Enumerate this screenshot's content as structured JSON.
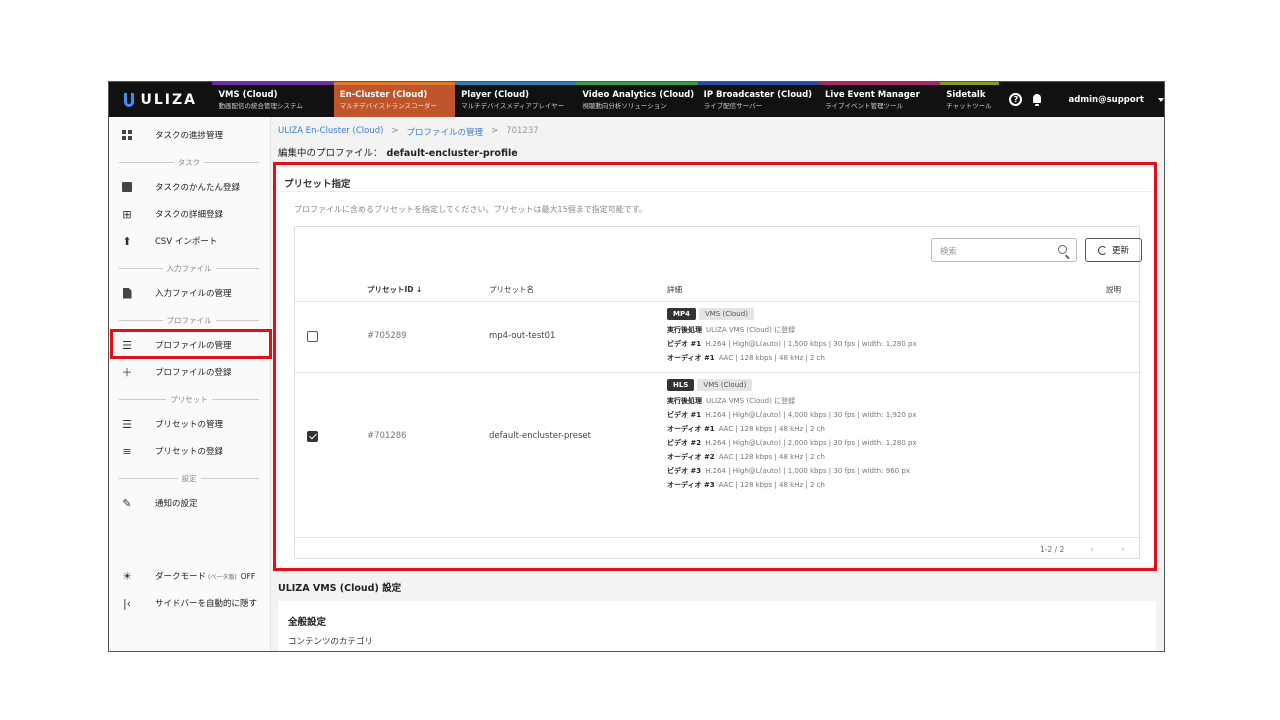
{
  "brand": {
    "logo": "ULIZA"
  },
  "nav": [
    {
      "title": "VMS (Cloud)",
      "sub": "動画配信の統合管理システム",
      "color": "#6b2fa0"
    },
    {
      "title": "En-Cluster (Cloud)",
      "sub": "マルチデバイストランスコーダー",
      "color": "#e07a2a",
      "active": true
    },
    {
      "title": "Player (Cloud)",
      "sub": "マルチデバイスメディアプレイヤー",
      "color": "#2f7fa8"
    },
    {
      "title": "Video Analytics (Cloud)",
      "sub": "視聴動向分析ソリューション",
      "color": "#3a9a4a"
    },
    {
      "title": "IP Broadcaster (Cloud)",
      "sub": "ライブ配信サーバー",
      "color": "#2a4fa0"
    },
    {
      "title": "Live Event Manager",
      "sub": "ライブイベント管理ツール",
      "color": "#a02a6b"
    },
    {
      "title": "Sidetalk",
      "sub": "チャットツール",
      "color": "#8a9a2a"
    }
  ],
  "topright": {
    "help_icon": "?",
    "user": "admin@support"
  },
  "sidebar": {
    "task_progress": "タスクの進捗管理",
    "div_task": "タスク",
    "task_easy": "タスクのかんたん登録",
    "task_detail": "タスクの詳細登録",
    "csv_import": "CSV インポート",
    "div_input": "入力ファイル",
    "input_manage": "入力ファイルの管理",
    "div_profile": "プロファイル",
    "profile_manage": "プロファイルの管理",
    "profile_register": "プロファイルの登録",
    "div_preset": "プリセット",
    "preset_manage": "プリセットの管理",
    "preset_register": "プリセットの登録",
    "div_settings": "設定",
    "notify_settings": "通知の設定",
    "dark_mode": "ダークモード",
    "beta": "(ベータ版)",
    "dark_state": "OFF",
    "auto_hide": "サイドバーを自動的に隠す"
  },
  "breadcrumb": {
    "root": "ULIZA En-Cluster (Cloud)",
    "sep": ">",
    "mid": "プロファイルの管理",
    "current": "701237"
  },
  "editing": {
    "label": "編集中のプロファイル：",
    "name": "default-encluster-profile"
  },
  "preset": {
    "title": "プリセット指定",
    "desc": "プロファイルに含めるプリセットを指定してください。プリセットは最大15個まで指定可能です。",
    "search_placeholder": "検索",
    "refresh": "更新",
    "headers": {
      "id": "プリセットID",
      "name": "プリセット名",
      "detail": "詳細",
      "note": "説明"
    },
    "rows": [
      {
        "checked": false,
        "id": "#705289",
        "name": "mp4-out-test01",
        "format": "MP4",
        "target": "VMS (Cloud)",
        "lines": [
          {
            "k": "実行後処理",
            "v": "ULIZA VMS (Cloud) に登録"
          },
          {
            "k": "ビデオ #1",
            "v": "H.264 | High@L(auto) | 1,500 kbps | 30 fps | width: 1,280 px"
          },
          {
            "k": "オーディオ #1",
            "v": "AAC | 128 kbps | 48 kHz | 2 ch"
          }
        ]
      },
      {
        "checked": true,
        "id": "#701286",
        "name": "default-encluster-preset",
        "format": "HLS",
        "target": "VMS (Cloud)",
        "lines": [
          {
            "k": "実行後処理",
            "v": "ULIZA VMS (Cloud) に登録"
          },
          {
            "k": "ビデオ #1",
            "v": "H.264 | High@L(auto) | 4,000 kbps | 30 fps | width: 1,920 px"
          },
          {
            "k": "オーディオ #1",
            "v": "AAC | 128 kbps | 48 kHz | 2 ch"
          },
          {
            "k": "ビデオ #2",
            "v": "H.264 | High@L(auto) | 2,000 kbps | 30 fps | width: 1,280 px"
          },
          {
            "k": "オーディオ #2",
            "v": "AAC | 128 kbps | 48 kHz | 2 ch"
          },
          {
            "k": "ビデオ #3",
            "v": "H.264 | High@L(auto) | 1,000 kbps | 30 fps | width: 960 px"
          },
          {
            "k": "オーディオ #3",
            "v": "AAC | 128 kbps | 48 kHz | 2 ch"
          }
        ]
      }
    ],
    "pager": "1-2 / 2"
  },
  "vms": {
    "title": "ULIZA VMS (Cloud) 設定",
    "general": "全般設定",
    "category": "コンテンツのカテゴリ"
  }
}
